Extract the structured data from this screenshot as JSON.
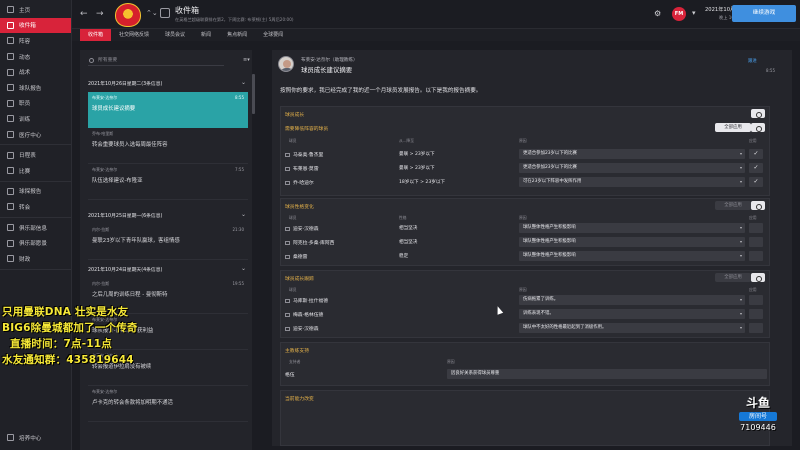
{
  "header": {
    "title": "收件箱",
    "subtitle": "在英格兰超级联赛排在第2，下周比赛: 布莱顿(主) 5周后20:00)",
    "date_main": "2021年10月26日星期二",
    "date_sub": "晚上 16:30",
    "continue_label": "继续游戏",
    "back_label": "←",
    "forward_label": "→"
  },
  "tabs": [
    "收件箱",
    "社交网络反馈",
    "球员会议",
    "新闻",
    "焦点新闻",
    "全球要闻"
  ],
  "nav": [
    {
      "label": "主页",
      "active": false
    },
    {
      "label": "收件箱",
      "active": true
    },
    {
      "label": "阵容",
      "active": false
    },
    {
      "label": "动态",
      "active": false
    },
    {
      "label": "战术",
      "active": false
    },
    {
      "label": "球队报告",
      "active": false
    },
    {
      "label": "职员",
      "active": false
    },
    {
      "label": "训练",
      "active": false
    },
    {
      "label": "医疗中心",
      "active": false
    },
    {
      "label": "日程表",
      "active": false
    },
    {
      "label": "比赛",
      "active": false
    },
    {
      "label": "球探报告",
      "active": false
    },
    {
      "label": "转会",
      "active": false
    },
    {
      "label": "俱乐部信息",
      "active": false
    },
    {
      "label": "俱乐部愿景",
      "active": false
    },
    {
      "label": "财政",
      "active": false
    },
    {
      "label": "培养中心",
      "active": false
    }
  ],
  "inbox": {
    "search_placeholder": "所有重要",
    "filter_label": "≡▾",
    "groups": [
      {
        "header": "2021年10月26日星期二(3条信息)"
      },
      {
        "header": "2021年10月25日星期一(6条信息)"
      },
      {
        "header": "2021年10月24日星期天(4条信息)"
      }
    ],
    "messages": [
      {
        "from": "布莱安·达奈尔",
        "subject": "球员成长建议摘要",
        "time": "8:55",
        "selected": true
      },
      {
        "from": "乔布·哈里斯",
        "subject": "转会重要球员入选每周最佳阵容",
        "time": "",
        "selected": false
      },
      {
        "from": "布莱安·达奈尔",
        "subject": "队伍选择建议-布隆亚",
        "time": "7:55",
        "selected": false
      },
      {
        "from": "内尔·拉斯",
        "subject": "曼联23岁以下青年队赢球，客组情感",
        "time": "21:30",
        "selected": false
      },
      {
        "from": "内尔·拉斯",
        "subject": "之后几周的训练日程 - 曼彻斯特",
        "time": "19:55",
        "selected": false
      },
      {
        "from": "布莱安·达奈尔",
        "subject": "球队报告-萨维尔斯获利益",
        "time": "",
        "selected": false
      },
      {
        "from": "布莱安·达奈尔",
        "subject": "转会报道伊拉肩没有被续",
        "time": "",
        "selected": false
      },
      {
        "from": "布莱安·达奈尔",
        "subject": "卢卡克的转会条款将加明期不通活",
        "time": "",
        "selected": false
      }
    ]
  },
  "reading": {
    "from": "布莱安·达奈尔（助理教练）",
    "subject": "球员成长建议摘要",
    "follow_label": "跟进",
    "time": "8:55",
    "intro": "按照你的要求，我已经完成了我的近一个月球员发展报告。以下是我的报告摘要。",
    "sections": [
      {
        "title": "球员成长",
        "subtitle": "需要降低阵容的球员",
        "apply_label": "全部应用",
        "apply_enabled": true,
        "cols": [
          "球员",
          "从...降至",
          "原因",
          "应用"
        ],
        "rows": [
          {
            "name": "马泰奥·鲁杰里",
            "crit": "曼联 > 23岁以下",
            "reason": "更适合参加23岁以下的比赛",
            "check": "✓"
          },
          {
            "name": "布莱恩·莫雷",
            "crit": "曼联 > 23岁以下",
            "reason": "更适合参加23岁以下的比赛",
            "check": "✓"
          },
          {
            "name": "乔·哈迪尔",
            "crit": "18岁以下 > 23岁以下",
            "reason": "可在23岁以下阵容中发挥作用",
            "check": "✓"
          }
        ]
      },
      {
        "title": "球员性格变化",
        "apply_label": "全部应用",
        "apply_enabled": false,
        "cols": [
          "球员",
          "性格",
          "原因",
          "应用"
        ],
        "rows": [
          {
            "name": "迪安·汉德森",
            "crit": "相当坚决",
            "reason": "球队整体性格产生积极影响",
            "check": ""
          },
          {
            "name": "阿克拉·多桑·库阿西",
            "crit": "相当坚决",
            "reason": "球队整体性格产生积极影响",
            "check": ""
          },
          {
            "name": "桑德雷",
            "crit": "稳定",
            "reason": "球队整体性格产生积极影响",
            "check": ""
          }
        ]
      },
      {
        "title": "球员成长跟踪",
        "apply_label": "全部应用",
        "apply_enabled": false,
        "cols": [
          "球员",
          "",
          "原因",
          "应用"
        ],
        "rows": [
          {
            "name": "马库斯·拉什福德",
            "crit": "",
            "reason": "伤病拖累了训练。",
            "check": ""
          },
          {
            "name": "梅森·格林伍德",
            "crit": "",
            "reason": "训练表现不错。",
            "check": ""
          },
          {
            "name": "迪安·汉德森",
            "crit": "",
            "reason": "球队中不太好的性格最近起到了消极作用。",
            "check": ""
          }
        ]
      },
      {
        "title": "主教练支持",
        "apply_label": "",
        "apply_enabled": false,
        "cols": [
          "支持者",
          "",
          "原因",
          ""
        ],
        "rows": [
          {
            "name": "格伍",
            "crit": "",
            "reason": "因良好关系获得球员尊重",
            "check": ""
          }
        ]
      },
      {
        "title": "当前能力改变",
        "apply_label": "",
        "apply_enabled": false,
        "cols": [],
        "rows": []
      }
    ]
  },
  "overlay": {
    "line1": "只用曼联DNA 壮实是水友",
    "line2": "BIG6除曼城都加了一个传奇",
    "line3": "直播时间：7点-11点",
    "line4": "水友通知群：435819644"
  },
  "watermark": {
    "logo": "斗鱼",
    "room_label": "房间号",
    "room_number": "7109446"
  },
  "colors": {
    "accent_red": "#d8233a",
    "selected_teal": "#2aa3a6",
    "continue_blue": "#3f8fdf",
    "section_gold": "#e3b14a",
    "overlay_yellow": "#f6e837"
  }
}
